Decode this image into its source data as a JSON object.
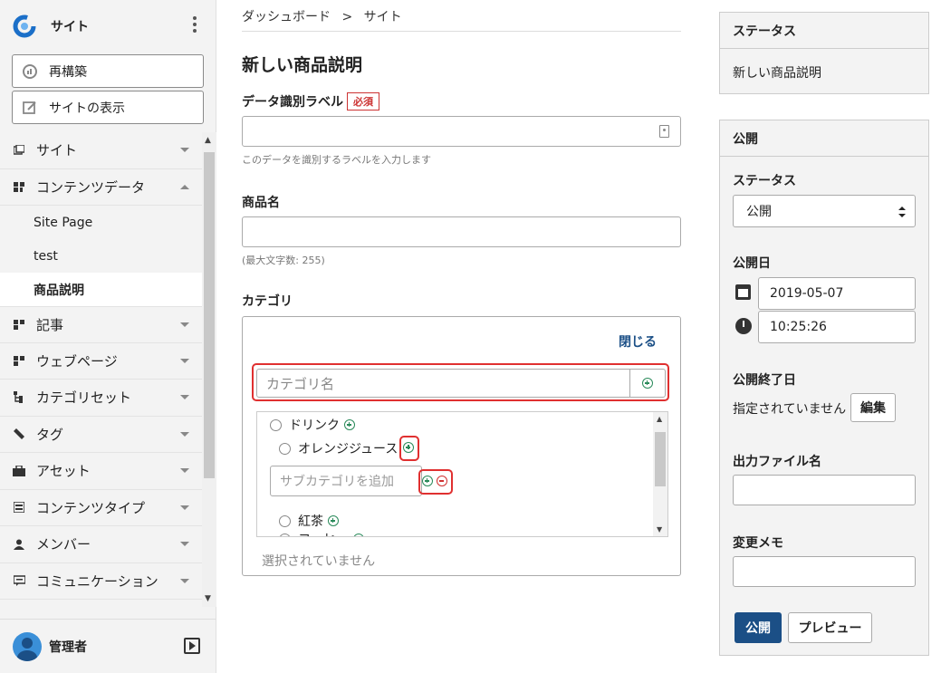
{
  "sidebar": {
    "site_name": "サイト",
    "rebuild_label": "再構築",
    "view_site_label": "サイトの表示",
    "items": [
      {
        "label": "サイト",
        "icon": "site-icon"
      },
      {
        "label": "コンテンツデータ",
        "icon": "content-data-icon",
        "expanded": true
      },
      {
        "label": "記事",
        "icon": "entry-icon"
      },
      {
        "label": "ウェブページ",
        "icon": "webpage-icon"
      },
      {
        "label": "カテゴリセット",
        "icon": "category-set-icon"
      },
      {
        "label": "タグ",
        "icon": "tag-icon"
      },
      {
        "label": "アセット",
        "icon": "asset-icon"
      },
      {
        "label": "コンテンツタイプ",
        "icon": "content-type-icon"
      },
      {
        "label": "メンバー",
        "icon": "member-icon"
      },
      {
        "label": "コミュニケーション",
        "icon": "communication-icon"
      }
    ],
    "sub_items": [
      "Site Page",
      "test",
      "商品説明"
    ],
    "user_name": "管理者"
  },
  "breadcrumb": {
    "home": "ダッシュボード",
    "separator": ">",
    "current": "サイト"
  },
  "main": {
    "title": "新しい商品説明",
    "data_label": {
      "label": "データ識別ラベル",
      "required": "必須",
      "value": "",
      "help": "このデータを識別するラベルを入力します"
    },
    "product_name": {
      "label": "商品名",
      "value": "",
      "help": "(最大文字数: 255)"
    },
    "category": {
      "label": "カテゴリ",
      "close_label": "閉じる",
      "name_placeholder": "カテゴリ名",
      "tree": [
        {
          "label": "ドリンク",
          "level": 0
        },
        {
          "label": "オレンジジュース",
          "level": 1
        },
        {
          "label": "紅茶",
          "level": 1
        },
        {
          "label": "コーヒー",
          "level": 1
        }
      ],
      "sub_placeholder": "サブカテゴリを追加",
      "none_selected": "選択されていません"
    }
  },
  "status_panel": {
    "title": "ステータス",
    "value": "新しい商品説明"
  },
  "publish_panel": {
    "title": "公開",
    "status_label": "ステータス",
    "status_value": "公開",
    "date_label": "公開日",
    "date_value": "2019-05-07",
    "time_value": "10:25:26",
    "end_label": "公開終了日",
    "end_value": "指定されていません",
    "edit_label": "編集",
    "file_label": "出力ファイル名",
    "file_value": "",
    "memo_label": "変更メモ",
    "memo_value": "",
    "publish_button": "公開",
    "preview_button": "プレビュー"
  },
  "colors": {
    "accent": "#1b4f86",
    "required": "#cc3333",
    "highlight": "#e03030",
    "add": "#2a8a5a"
  }
}
